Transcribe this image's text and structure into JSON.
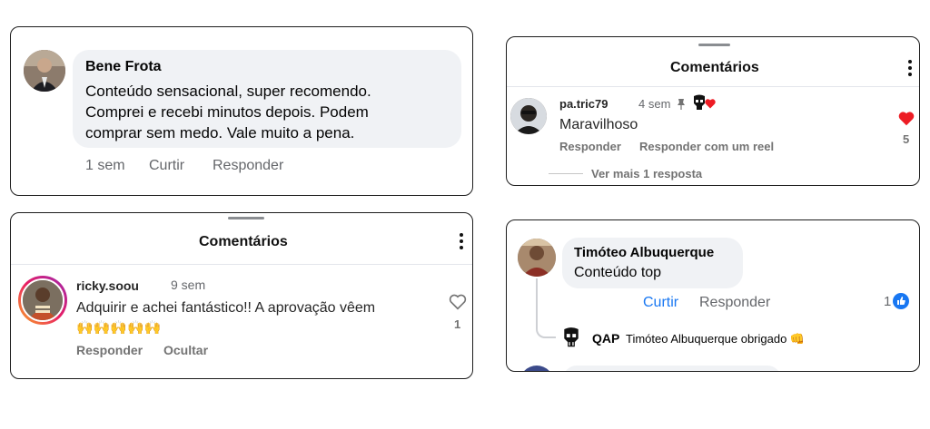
{
  "card1": {
    "name": "Bene Frota",
    "text_lines": [
      "Conteúdo sensacional, super recomendo.",
      "Comprei e recebi minutos depois. Podem",
      "comprar sem medo. Vale muito a pena."
    ],
    "time": "1 sem",
    "like": "Curtir",
    "reply": "Responder"
  },
  "card2": {
    "header": "Comentários",
    "username": "pa.tric79",
    "time": "4 sem",
    "text": "Maravilhoso",
    "reply": "Responder",
    "reply_reel": "Responder com um reel",
    "likes": "5",
    "more_replies": "Ver mais 1 resposta",
    "icons": [
      "pin-icon",
      "punisher-icon",
      "red-heart-icon"
    ]
  },
  "card3": {
    "header": "Comentários",
    "username": "ricky.soou",
    "time": "9 sem",
    "text_line1": "Adquirir e achei fantástico!! A aprovação vêem",
    "emojis": "🙌🙌🙌🙌🙌",
    "reply": "Responder",
    "hide": "Ocultar",
    "likes": "1"
  },
  "card4": {
    "name": "Timóteo Albuquerque",
    "text": "Conteúdo top",
    "like": "Curtir",
    "reply": "Responder",
    "like_count": "1",
    "reply_author": "QAP",
    "reply_text": "Timóteo Albuquerque obrigado 👊"
  },
  "colors": {
    "like_blue": "#1877f2",
    "heart_red": "#ed4956",
    "grey_text": "#65676b",
    "bubble": "#f0f2f5"
  }
}
